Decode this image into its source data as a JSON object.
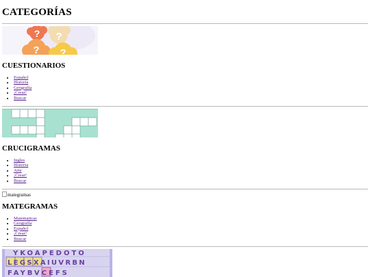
{
  "page_title": "CATEGORÍAS",
  "sections": [
    {
      "heading": "CUESTIONARIOS",
      "links": [
        "Español",
        "Historia",
        "Geografía",
        "¡Crear!",
        "Buscar"
      ]
    },
    {
      "heading": "CRUCIGRAMAS",
      "links": [
        "Ingles",
        "Historia",
        "Arte",
        "¡Crear!",
        "Buscar"
      ]
    },
    {
      "heading": "MATEGRAMAS",
      "image_alt": "mategramas",
      "links": [
        "Matematicas",
        "Geografía",
        "Español",
        "¡Crear!",
        "Buscar"
      ]
    }
  ],
  "wordsearch_rows": [
    "YKOAPEDOTO",
    "LEGSXAIUVRBN",
    "FAYBVCEFS"
  ],
  "colors": {
    "quiz_bubble_orange": "#f4a259",
    "quiz_bubble_yellow": "#f7c948",
    "crossword_teal": "#a8e1cf",
    "wordsearch_purple": "#6a3fa0",
    "wordsearch_lavender": "#d8d4f0",
    "link_visited": "#551a8b"
  }
}
